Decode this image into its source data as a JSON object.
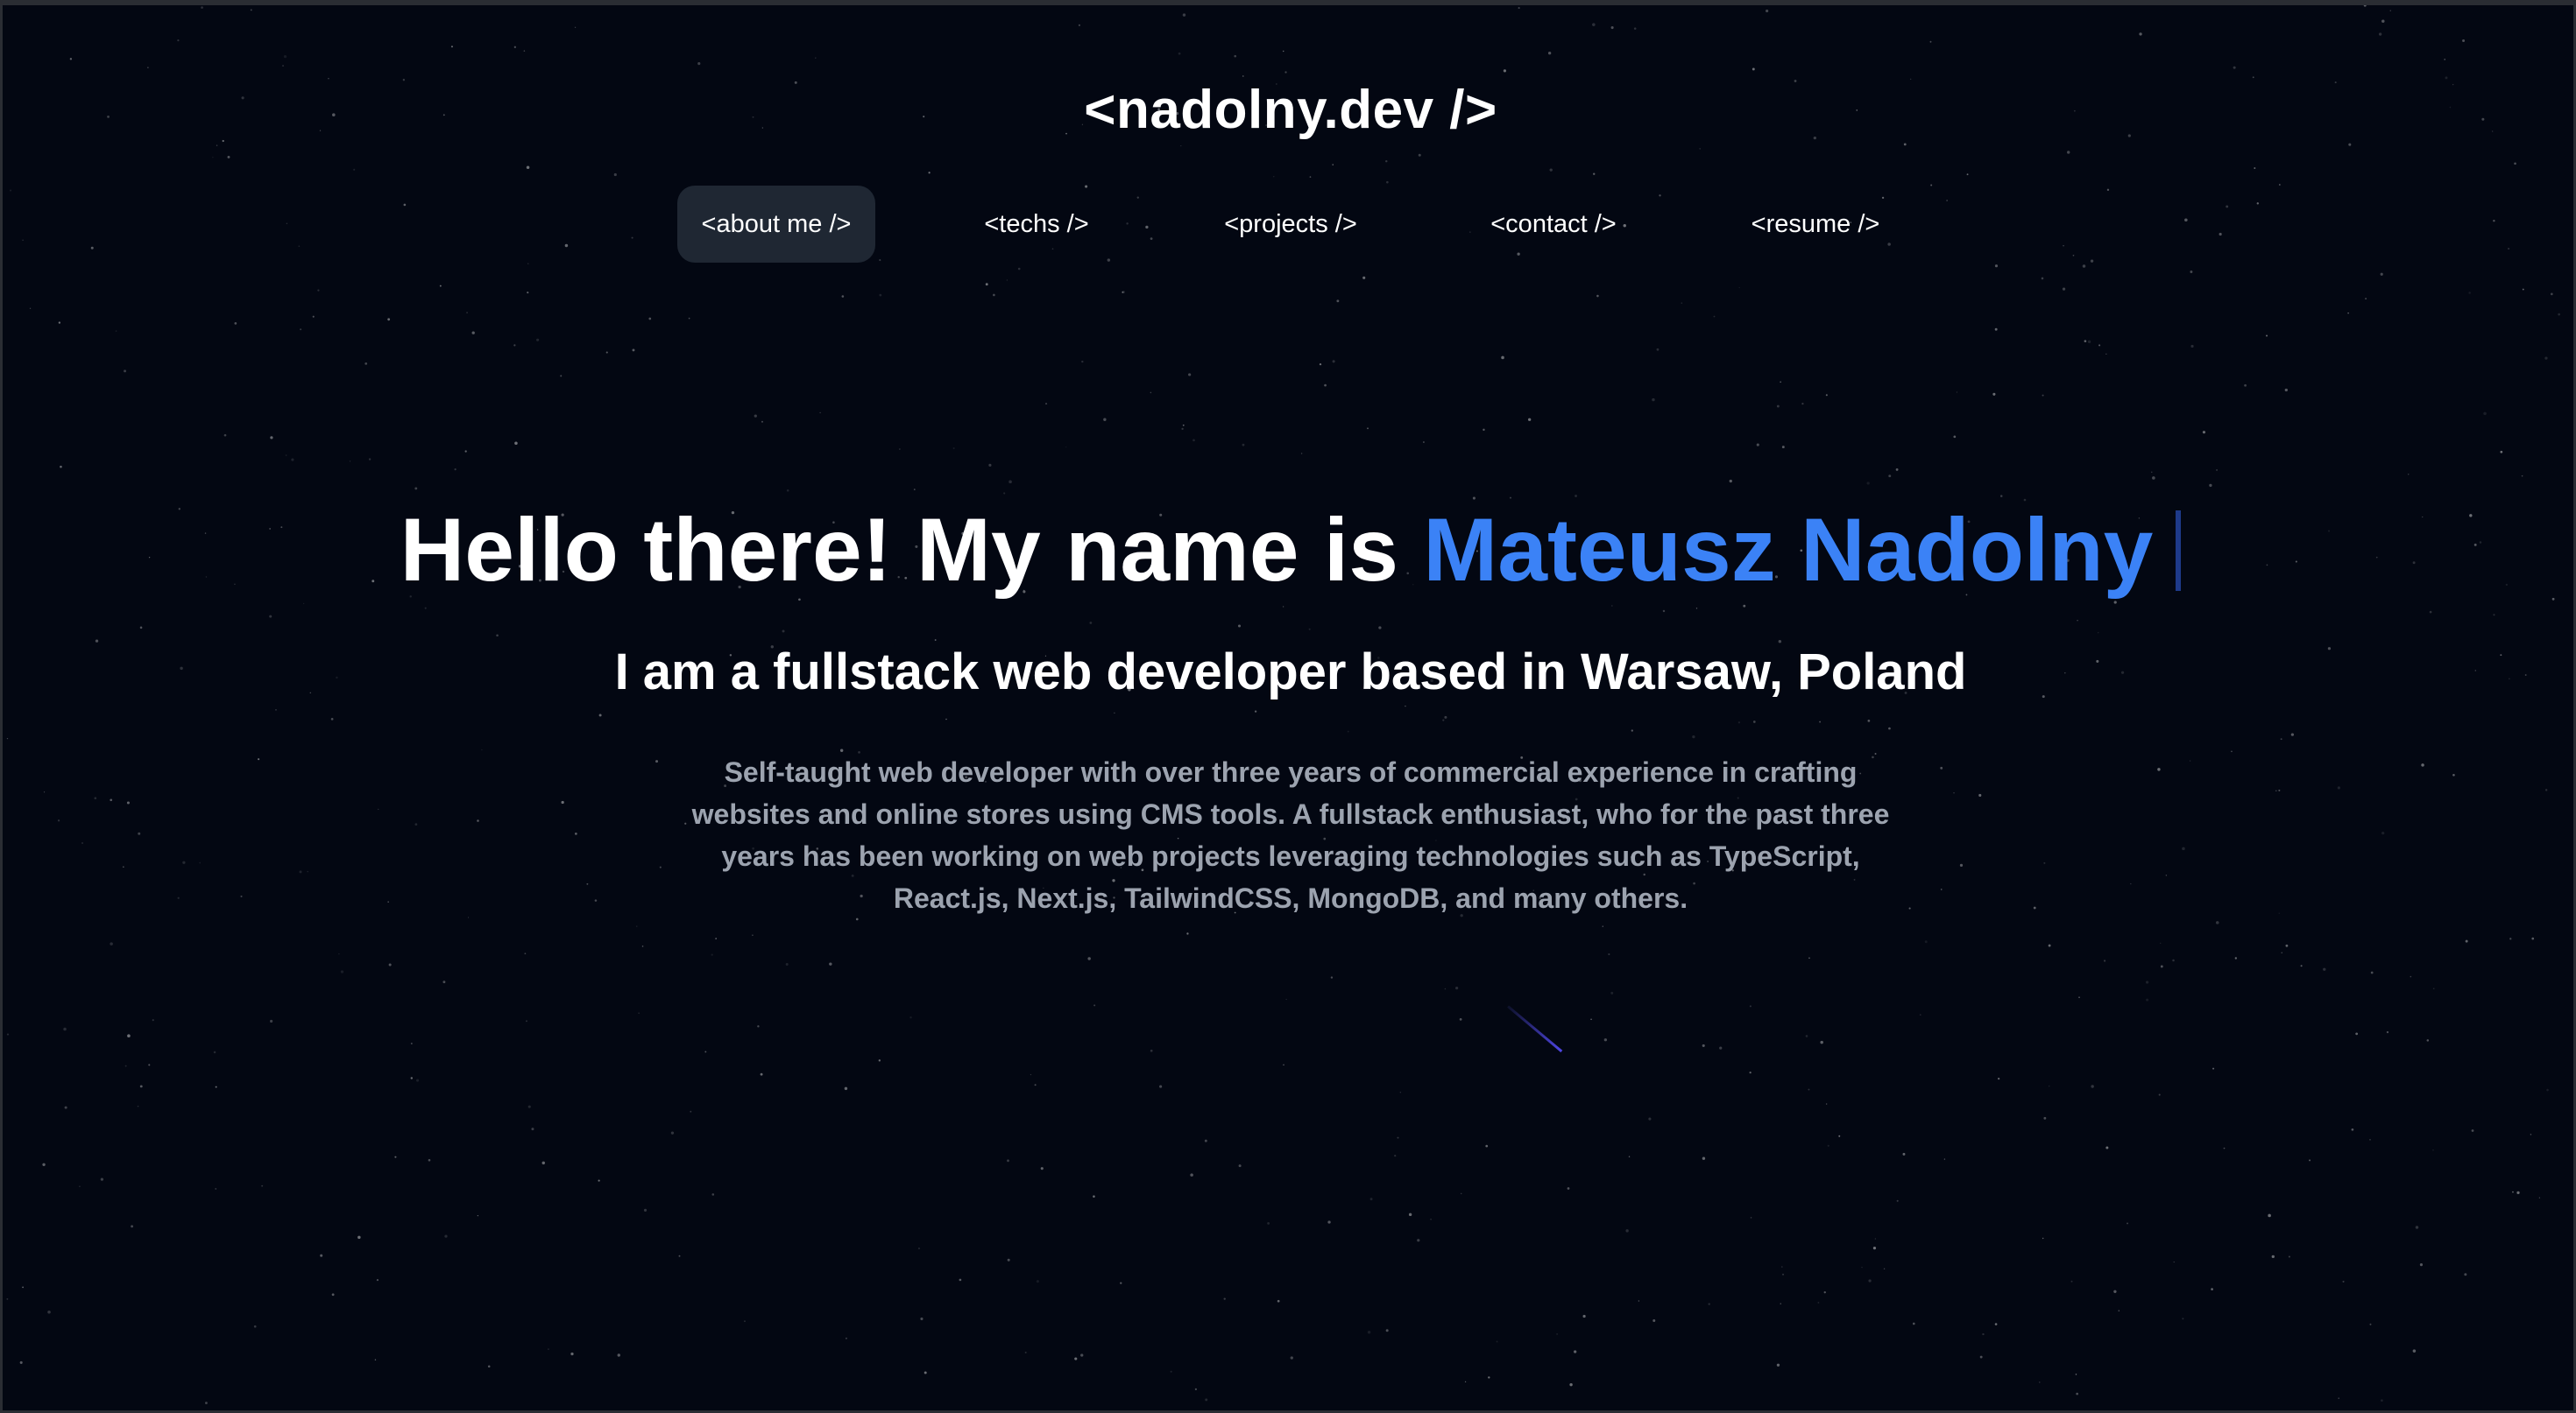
{
  "logo": "<nadolny.dev />",
  "nav": {
    "items": [
      {
        "label": "<about me />",
        "active": true
      },
      {
        "label": "<techs />",
        "active": false
      },
      {
        "label": "<projects />",
        "active": false
      },
      {
        "label": "<contact />",
        "active": false
      },
      {
        "label": "<resume />",
        "active": false
      }
    ]
  },
  "hero": {
    "greeting": "Hello there! My name is ",
    "name": "Mateusz Nadolny",
    "subtitle": "I am a fullstack web developer based in Warsaw, Poland",
    "bio": "Self-taught web developer with over three years of commercial experience in crafting websites and online stores using CMS tools. A fullstack enthusiast, who for the past three years has been working on web projects leveraging technologies such as TypeScript, React.js, Next.js, TailwindCSS, MongoDB, and many others."
  },
  "colors": {
    "background": "#030712",
    "accent": "#3b82f6",
    "nav_active_bg": "#1f2733",
    "bio_text": "#9ca3af",
    "cursor": "#1e3a8a"
  },
  "icons": {
    "background_decoration": "starfield",
    "shooting_star": "shooting-star"
  }
}
